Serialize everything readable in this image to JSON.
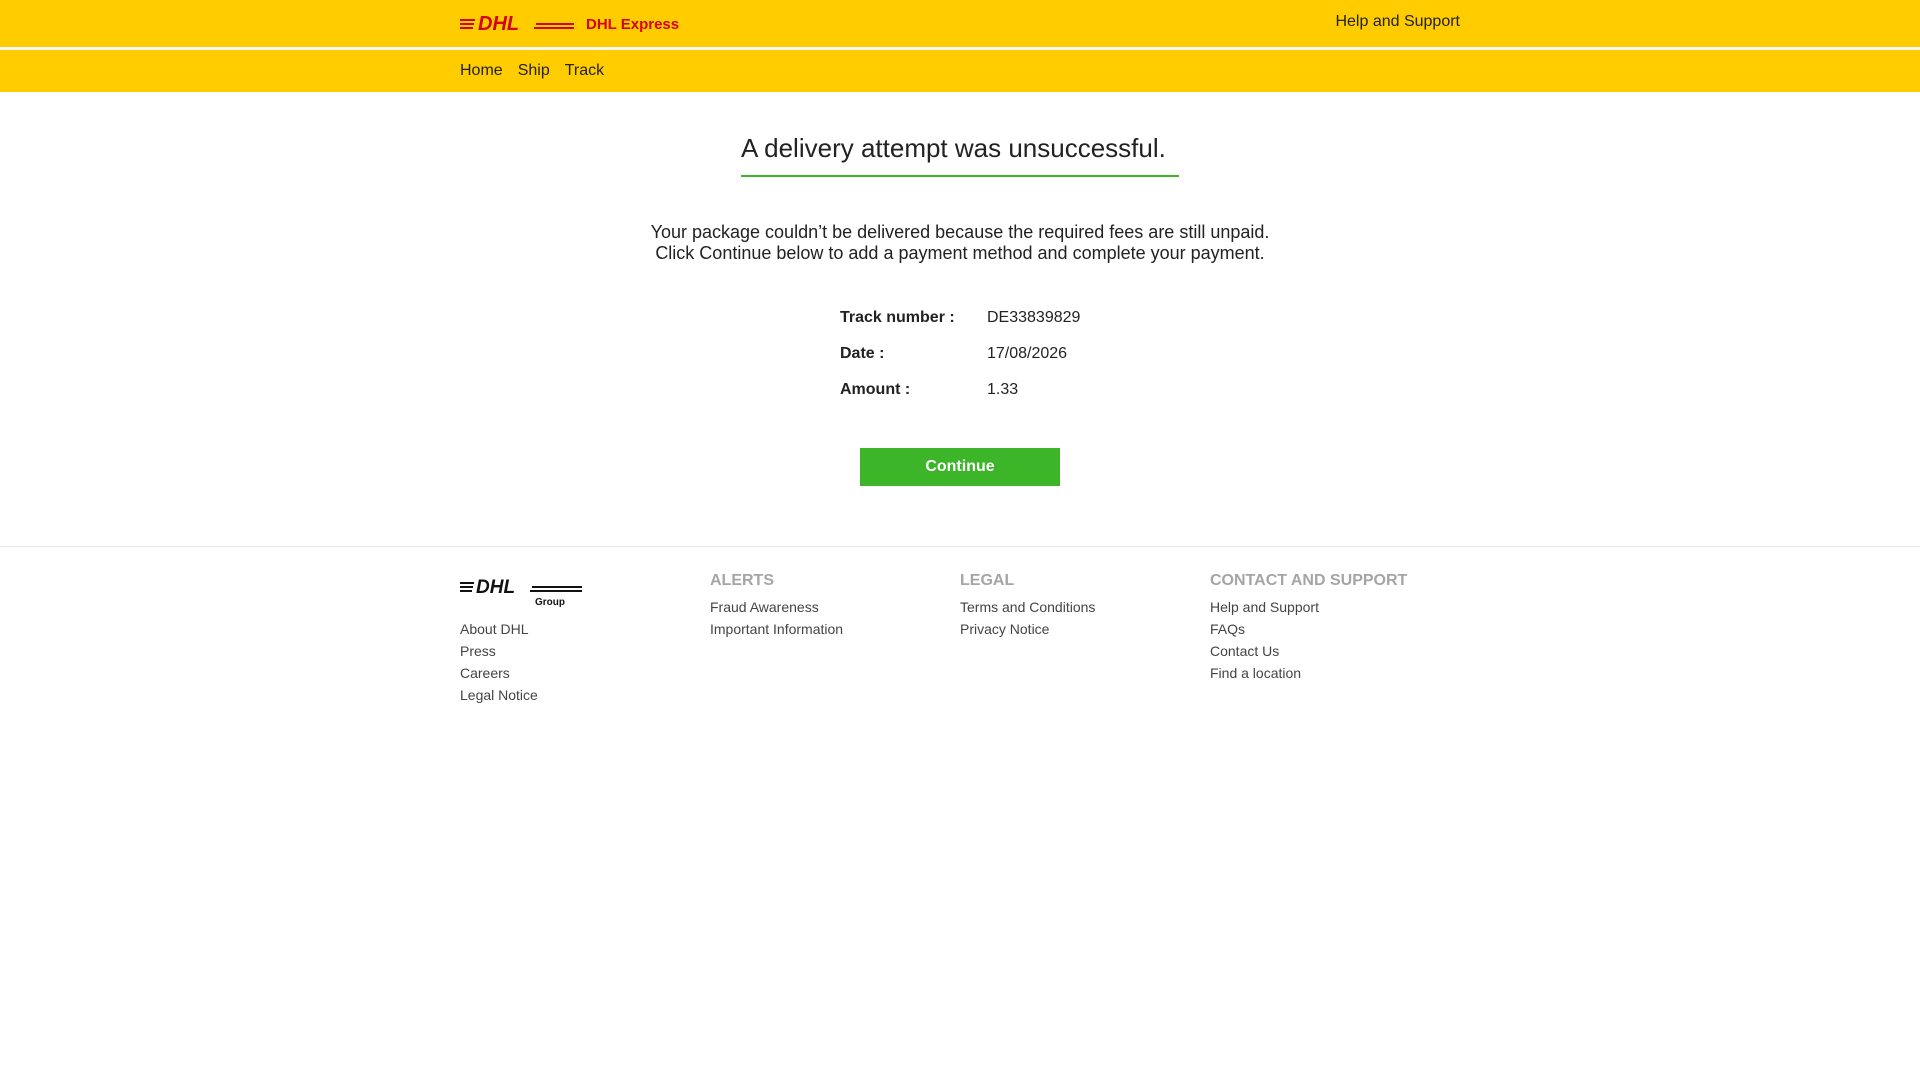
{
  "header": {
    "brand": "DHL Express",
    "help_label": "Help and Support"
  },
  "nav": {
    "items": [
      "Home",
      "Ship",
      "Track"
    ]
  },
  "main": {
    "title": "A delivery attempt was unsuccessful.",
    "message_line1": "Your package couldn’t be delivered because the required fees are still unpaid.",
    "message_line2": "Click Continue below to add a payment method and complete your payment.",
    "details": [
      {
        "label": "Track number :",
        "value": "DE33839829"
      },
      {
        "label": "Date :",
        "value": "17/08/2026"
      },
      {
        "label": "Amount :",
        "value": "1.33"
      }
    ],
    "continue_label": "Continue"
  },
  "footer": {
    "group_logo_text": "Group",
    "col1": {
      "links": [
        "About DHL",
        "Press",
        "Careers",
        "Legal Notice"
      ]
    },
    "col2": {
      "heading": "ALERTS",
      "links": [
        "Fraud Awareness",
        "Important Information"
      ]
    },
    "col3": {
      "heading": "LEGAL",
      "links": [
        "Terms and Conditions",
        "Privacy Notice"
      ]
    },
    "col4": {
      "heading": "CONTACT AND SUPPORT",
      "links": [
        "Help and Support",
        "FAQs",
        "Contact Us",
        "Find a location"
      ]
    }
  },
  "colors": {
    "brand_yellow": "#ffcc00",
    "brand_red": "#d40511",
    "action_green": "#3cb529"
  }
}
